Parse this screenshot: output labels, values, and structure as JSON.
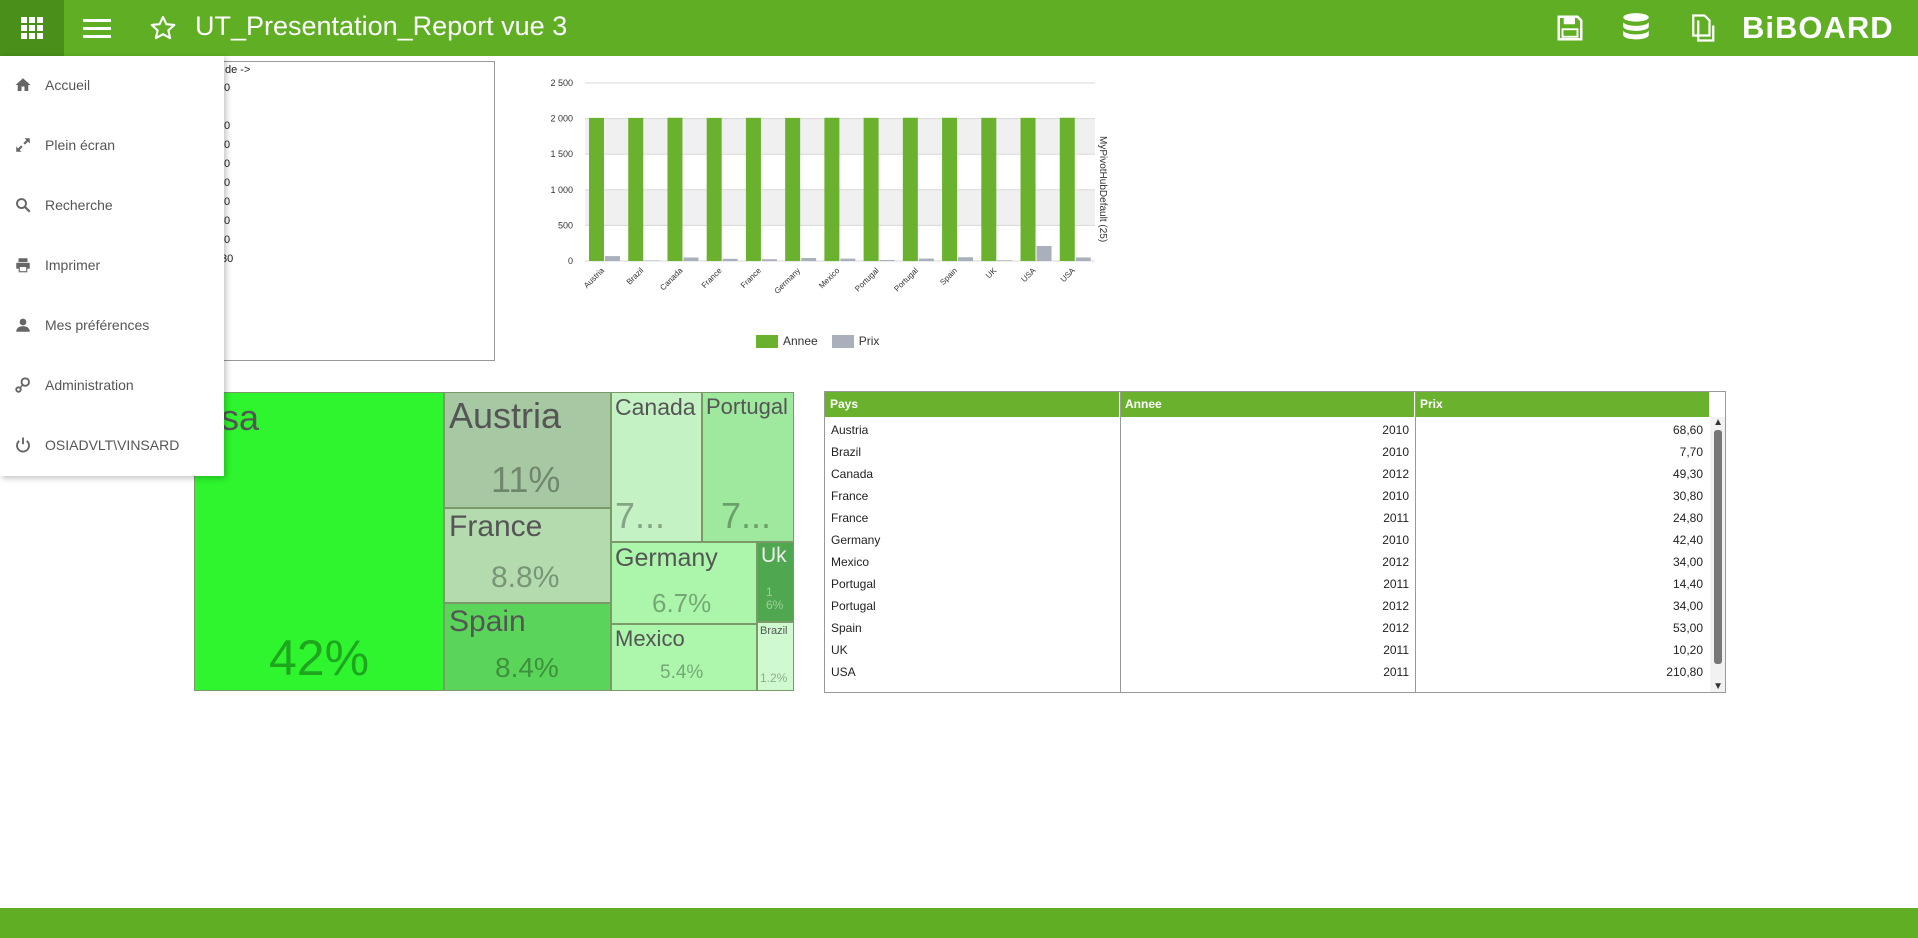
{
  "app": {
    "title": "UT_Presentation_Report vue 3",
    "logo": "BiBOARD",
    "brand_color": "#5fae24",
    "icons": [
      "apps-grid-icon",
      "hamburger-menu-icon",
      "favorite-star-icon",
      "save-icon",
      "database-icon",
      "documents-icon"
    ]
  },
  "menu": {
    "items": [
      {
        "label": "Accueil",
        "icon": "home-icon"
      },
      {
        "label": "Plein écran",
        "icon": "fullscreen-icon"
      },
      {
        "label": "Recherche",
        "icon": "search-icon"
      },
      {
        "label": "Imprimer",
        "icon": "print-icon"
      },
      {
        "label": "Mes préférences",
        "icon": "user-icon"
      },
      {
        "label": "Administration",
        "icon": "admin-settings-icon"
      },
      {
        "label": "OSIADVLT\\VINSARD",
        "icon": "power-icon"
      }
    ]
  },
  "text_panel": {
    "lines": [
      "de ->",
      "0",
      "",
      "0",
      "0",
      "0",
      "0",
      "0",
      "0",
      "0",
      "30"
    ]
  },
  "chart_data": {
    "type": "bar",
    "categories": [
      "Austria",
      "Brazil",
      "Canada",
      "France",
      "France",
      "Germany",
      "Mexico",
      "Portugal",
      "Portugal",
      "Spain",
      "UK",
      "USA",
      "USA"
    ],
    "series": [
      {
        "name": "Annee",
        "color": "#6ab12e",
        "values": [
          2010,
          2010,
          2012,
          2010,
          2011,
          2010,
          2012,
          2011,
          2012,
          2012,
          2011,
          2011,
          2012
        ]
      },
      {
        "name": "Prix",
        "color": "#a9afbb",
        "values": [
          68.6,
          7.7,
          49.3,
          30.8,
          24.8,
          42.4,
          34.0,
          14.4,
          34.0,
          53.0,
          10.2,
          210.8,
          50
        ]
      }
    ],
    "y_ticks": [
      "0",
      "500",
      "1 000",
      "1 500",
      "2 000",
      "2 500"
    ],
    "ylim": [
      0,
      2500
    ],
    "ylabel": "MyPivotHubDefault (25)",
    "xlabel": "",
    "title": "",
    "legend": "bottom",
    "grid": true
  },
  "treemap": {
    "cells": [
      {
        "name": "usa",
        "pct": "42%",
        "color": "#2ef52e"
      },
      {
        "name": "Austria",
        "pct": "11%",
        "color": "#a6c8a2"
      },
      {
        "name": "France",
        "pct": "8.8%",
        "color": "#b3dbae"
      },
      {
        "name": "Spain",
        "pct": "8.4%",
        "color": "#5ad55a"
      },
      {
        "name": "Canada",
        "pct": "7...",
        "color": "#c4f2c4"
      },
      {
        "name": "Portugal",
        "pct": "7...",
        "color": "#9ee99e"
      },
      {
        "name": "Germany",
        "pct": "6.7%",
        "color": "#acf6ac"
      },
      {
        "name": "Uk",
        "pct": "1 6%",
        "color": "#4fa84f"
      },
      {
        "name": "Mexico",
        "pct": "5.4%",
        "color": "#acf7ac"
      },
      {
        "name": "Brazil",
        "pct": "1.2%",
        "color": "#cffacf"
      }
    ]
  },
  "grid": {
    "columns": [
      "Pays",
      "Annee",
      "Prix"
    ],
    "rows": [
      [
        "Austria",
        "2010",
        "68,60"
      ],
      [
        "Brazil",
        "2010",
        "7,70"
      ],
      [
        "Canada",
        "2012",
        "49,30"
      ],
      [
        "France",
        "2010",
        "30,80"
      ],
      [
        "France",
        "2011",
        "24,80"
      ],
      [
        "Germany",
        "2010",
        "42,40"
      ],
      [
        "Mexico",
        "2012",
        "34,00"
      ],
      [
        "Portugal",
        "2011",
        "14,40"
      ],
      [
        "Portugal",
        "2012",
        "34,00"
      ],
      [
        "Spain",
        "2012",
        "53,00"
      ],
      [
        "UK",
        "2011",
        "10,20"
      ],
      [
        "USA",
        "2011",
        "210,80"
      ]
    ]
  }
}
